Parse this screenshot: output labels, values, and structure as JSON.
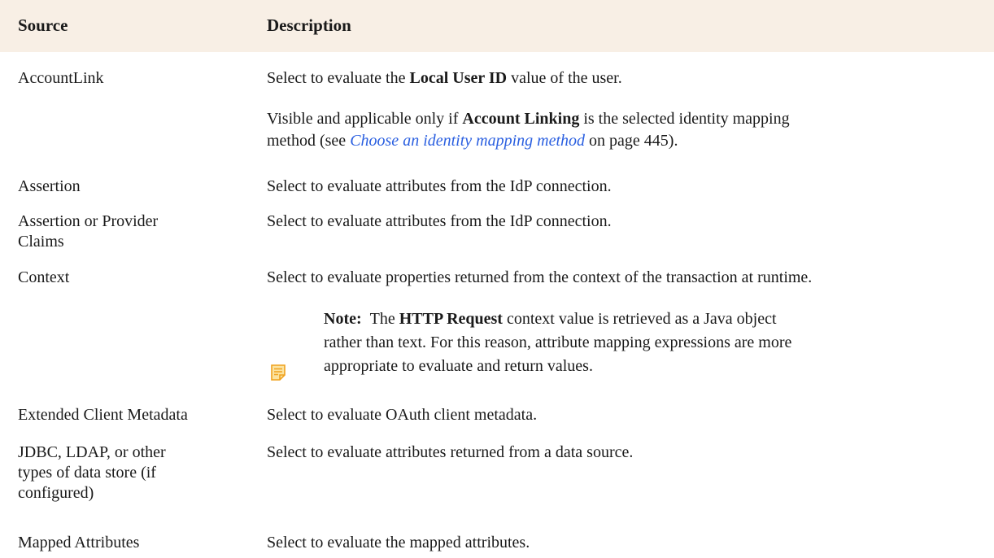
{
  "header": {
    "source": "Source",
    "description": "Description"
  },
  "rows": [
    {
      "source": "AccountLink",
      "desc_pre": "Select to evaluate the ",
      "desc_bold": "Local User ID",
      "desc_post": " value of the user.",
      "extra_bold": "Account Linking",
      "extra_line1_post": " is the selected identity mapping",
      "extra_line1_pre": "Visible and applicable only if ",
      "extra_line2_pre": "method (see ",
      "extra_link": "Choose an identity mapping method",
      "extra_line2_post": " on page 445)."
    },
    {
      "source": "Assertion",
      "desc": "Select to evaluate attributes from the IdP connection."
    },
    {
      "source_line1": "Assertion or Provider",
      "source_line2": "Claims",
      "desc": "Select to evaluate attributes from the IdP connection."
    },
    {
      "source": "Context",
      "desc": "Select to evaluate properties returned from the context of the transaction at runtime.",
      "note_label": "Note:",
      "note_pre": "The ",
      "note_bold": "HTTP Request",
      "note_line1_post": " context value is retrieved as a Java object",
      "note_line2": "rather than text. For this reason, attribute mapping expressions are more",
      "note_line3": "appropriate to evaluate and return values."
    },
    {
      "source": "Extended Client Metadata",
      "desc": "Select to evaluate OAuth client metadata."
    },
    {
      "source_line1": "JDBC, LDAP, or other",
      "source_line2": "types of data store (if",
      "source_line3": "configured)",
      "desc": "Select to evaluate attributes returned from a data source."
    },
    {
      "source": "Mapped Attributes",
      "desc": "Select to evaluate the mapped attributes."
    }
  ],
  "icons": {
    "note": "note-icon",
    "note_color": "#f0a21f"
  }
}
